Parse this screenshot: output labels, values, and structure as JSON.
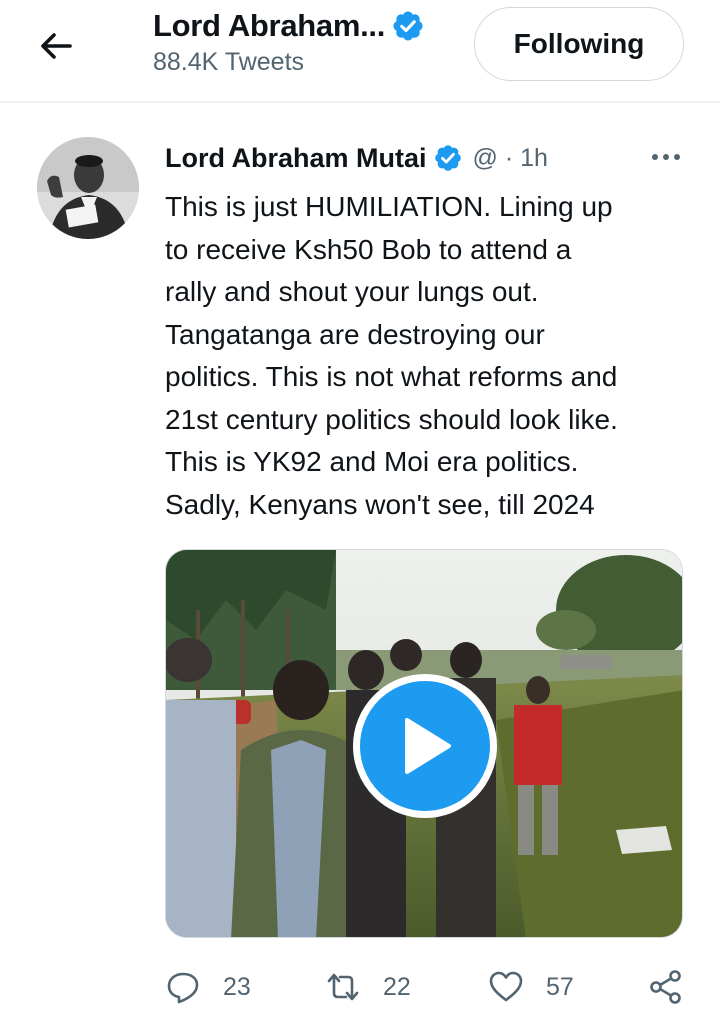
{
  "header": {
    "title": "Lord Abraham...",
    "subtitle": "88.4K Tweets",
    "follow_label": "Following"
  },
  "tweet": {
    "author_name": "Lord Abraham Mutai",
    "meta": "@ · 1h",
    "text": "This is just HUMILIATION. Lining up\nto receive Ksh50 Bob to attend a\nrally and shout your lungs out.\nTangatanga are destroying our\npolitics. This is not what reforms and\n21st century politics should look like.\nThis is YK92 and Moi era politics.\nSadly, Kenyans won't see, till 2024"
  },
  "actions": {
    "replies": "23",
    "retweets": "22",
    "likes": "57"
  },
  "icons": {
    "back": "back-arrow-icon",
    "verified": "verified-badge-icon",
    "more": "more-icon",
    "play": "play-icon",
    "reply": "reply-icon",
    "retweet": "retweet-icon",
    "like": "like-icon",
    "share": "share-icon"
  },
  "colors": {
    "accent": "#1d9bf0",
    "text": "#0f1419",
    "secondary": "#536471",
    "border": "#cfd9de"
  }
}
